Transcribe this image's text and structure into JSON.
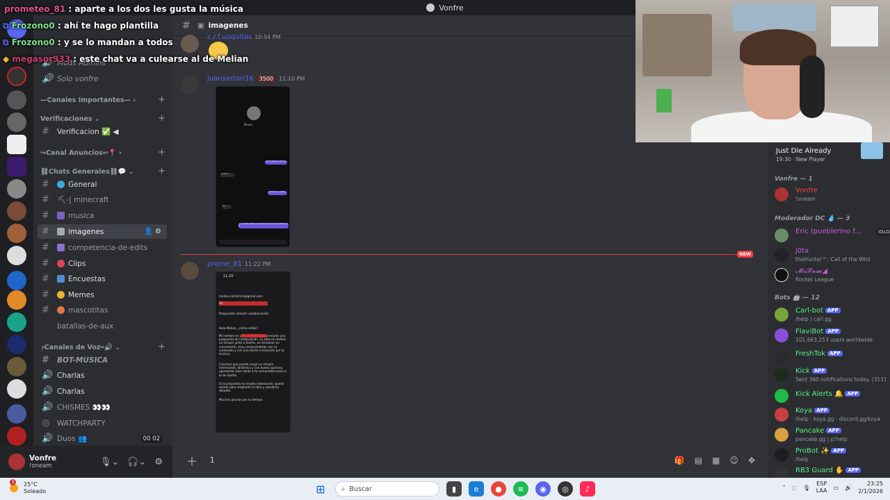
{
  "window": {
    "title": "Vonfre"
  },
  "overlay_chat": [
    {
      "user": "prometeo_81",
      "text": ": aparte a los dos les gusta la música"
    },
    {
      "user": "Frozono0",
      "text": ": ahí te hago plantilla"
    },
    {
      "user": "Frozono0",
      "text": ": y se lo mandan a todos"
    },
    {
      "user": "megasor933",
      "text": ": este chat va a culearse al de Melian"
    }
  ],
  "sidebar": {
    "categories": [
      {
        "label": "Mods Admins"
      },
      {
        "label": "Solo vonfre"
      },
      {
        "label": "—Canales Importantes—"
      },
      {
        "label": "Verificaciones"
      },
      {
        "label": "↪Canal Anuncios↩📍"
      },
      {
        "label": "⛓Chats Generales⛓💬"
      },
      {
        "label": "╒Canales de Voz═🔊"
      }
    ],
    "channels": [
      {
        "label": "Verificacion ✅ ◀"
      },
      {
        "label": "General"
      },
      {
        "label": "⛏-| minecraft"
      },
      {
        "label": "musica"
      },
      {
        "label": "imagenes"
      },
      {
        "label": "competencia-de-edits"
      },
      {
        "label": "Clips"
      },
      {
        "label": "Encuestas"
      },
      {
        "label": "Memes"
      },
      {
        "label": "mascotitas"
      },
      {
        "label": "batallas-de-aux"
      }
    ],
    "voice": [
      {
        "label": "BOT-MUSICA"
      },
      {
        "label": "Charlas"
      },
      {
        "label": "Charlas"
      },
      {
        "label": "CHISMES 👀👀"
      },
      {
        "label": "WATCHPARTY"
      },
      {
        "label": "Duos 👥",
        "badge": "00  02"
      }
    ]
  },
  "user_panel": {
    "name": "Vonfre",
    "status": "!oneam"
  },
  "chat": {
    "channel": "imagenes",
    "messages": [
      {
        "author": "c.r.f.uoquitas",
        "time": "10:54 PM",
        "color": "#5865f2"
      },
      {
        "author": "juansartori16",
        "badge": "3500",
        "time": "11:10 PM",
        "color": "#5865f2"
      },
      {
        "author": "prome_81",
        "time": "11:22 PM",
        "color": "#5865f2"
      }
    ],
    "new_badge": "NEW",
    "phone1": {
      "name": "Bruno",
      "bubbles": [
        "Lorem ipsum un archivo mediante",
        "Bandana",
        "La llamada a Vonfre",
        "Bien",
        "Sí, ya sé las entrar con el dinero y hacer lo que tienes en la"
      ]
    },
    "email": {
      "time": "11:20",
      "from": "melian.contacto1@gmail.com",
      "to": "De",
      "subject": "Propuesta stream colaboración.",
      "greeting": "Hola Melian, ¿cómo estás?",
      "p1": "Mi nombre es                    y te escribo para acercarte una propuesta de colaboración. La idea es realizar un stream junto a Vonfre, un streamer en crecimiento, muy comprometido con su contenido y con una fuerte inclinación por la música.",
      "p2": "Creemos que puede surgir un stream interesante, dinámico y con buena química, aportando valor tanto a tu comunidad como a la de Vonfre.",
      "p3": "Si la propuesta te resulta interesante, quedo atento para ampliarte la idea y coordinar detalles.",
      "p4": "Muchas gracias por tu tiempo."
    },
    "composer_value": "1"
  },
  "members": {
    "top": {
      "name": "Just Die Already",
      "status": "19:30 · New Player"
    },
    "groups": [
      {
        "label": "Vonfre — 1",
        "items": [
          {
            "name": "Vonfre",
            "status": "!oneam",
            "color": "#f23f43"
          }
        ]
      },
      {
        "label": "Moderador DC 💧 — 3",
        "items": [
          {
            "name": "Eric (pueblerino f...",
            "status": "",
            "tag": "IGLO",
            "color": "#c95bd6"
          },
          {
            "name": "j0ta",
            "status": "theHunter™: Call of the Wild",
            "color": "#c95bd6"
          },
          {
            "name": "𝓜𝓻𝓢𝓪𝓶◢",
            "status": "Rocket League",
            "color": "#c95bd6"
          }
        ]
      },
      {
        "label": "Bots 🤖 — 12",
        "items": [
          {
            "name": "Carl-bot",
            "status": "/help | carl.gg",
            "app": "APP",
            "color": "#57f287"
          },
          {
            "name": "FlaviBot",
            "status": "101,663,253 users worldwide",
            "app": "APP",
            "color": "#57f287"
          },
          {
            "name": "FreshTok",
            "status": "",
            "app": "APP",
            "color": "#57f287"
          },
          {
            "name": "Kick",
            "status": "Sent 360 notifications today. (3131...",
            "app": "APP",
            "color": "#57f287"
          },
          {
            "name": "Kick Alerts 🔔",
            "status": "",
            "app": "APP",
            "color": "#57f287"
          },
          {
            "name": "Koya",
            "status": "/help · koya.gg · discord.gg/koya",
            "app": "APP",
            "color": "#57f287"
          },
          {
            "name": "Pancake",
            "status": "pancake.gg | p!help",
            "app": "APP",
            "color": "#57f287"
          },
          {
            "name": "ProBot ✨",
            "status": "/help",
            "app": "APP",
            "color": "#57f287"
          },
          {
            "name": "RB3 Guard ✋",
            "status": "",
            "app": "APP",
            "color": "#57f287"
          }
        ]
      }
    ]
  },
  "taskbar": {
    "weather_temp": "25°C",
    "weather_desc": "Soleado",
    "weather_badge": "3",
    "search_placeholder": "Buscar",
    "lang1": "ESP",
    "lang2": "LAA",
    "time": "23:25",
    "date": "2/1/2026"
  }
}
